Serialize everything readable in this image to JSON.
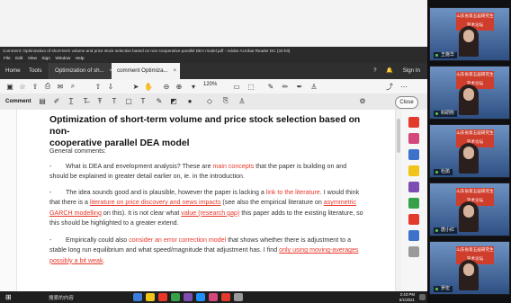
{
  "app": {
    "window_title": "Comment: Optimization of short-term volume and price stock selection based on non-cooperative parallel DEA model.pdf - Adobe Acrobat Reader DC (32-bit)",
    "menu": [
      "File",
      "Edit",
      "View",
      "Sign",
      "Window",
      "Help"
    ],
    "tabs": [
      {
        "label": "Home"
      },
      {
        "label": "Tools"
      },
      {
        "label": "Optimization of sh..."
      },
      {
        "label": "comment Optimiza..."
      }
    ],
    "top_right": {
      "help": "?",
      "bell": "🔔",
      "signin": "Sign In"
    },
    "toolbar_zoom": "120%",
    "comment_toolbar": {
      "label": "Comment",
      "close_label": "Close"
    }
  },
  "document": {
    "title_line1": "Optimization of short-term volume and price stock selection based on non-",
    "title_line2": "cooperative parallel DEA model",
    "section_heading": "General comments:",
    "p1_dash": "-",
    "p1_pre": "What is DEA and envelopment analysis? These are ",
    "p1_hl": "main concepts",
    "p1_post": " that the paper is building on and should be explained in greater detail earlier on, ie. in the introduction.",
    "p2_dash": "-",
    "p2_a": "The idea sounds good and is plausible, however the paper is lacking a ",
    "p2_hl1": "link to the literature",
    "p2_b": ". I would think that there is a ",
    "p2_hl2": "literature on price discovery and news impacts",
    "p2_c": " (see also the empirical literature on ",
    "p2_hl3": "asymmetric GARCH modelling",
    "p2_d": " on this). It is not clear what ",
    "p2_hl4": "value (research gap)",
    "p2_e": " this paper adds to the existing literature, so this should be highlighted to a greater extend.",
    "p3_dash": "-",
    "p3_a": "Empirically could also ",
    "p3_hl1": "consider an error correction model",
    "p3_b": " that shows whether there is adjustment to a stable long run equilibrium and what speed/magnitude that adjustment has. I find ",
    "p3_hl2": "only using moving-averages possibly a bit weak",
    "p3_c": "."
  },
  "video_call": {
    "banner_text": "山东省第五届研究生学术论坛",
    "participants": [
      {
        "name": "王施华"
      },
      {
        "name": "科研所"
      },
      {
        "name": "杜鹃"
      },
      {
        "name": "唐小红"
      },
      {
        "name": "罗宏"
      }
    ]
  },
  "taskbar": {
    "search_text": "搜索的内容",
    "time": "2:43 PM",
    "date": "6/1/2021"
  },
  "colors": {
    "accent_red": "#e8372a",
    "comment_tool_yellow": "#f0c419",
    "taskbar": "#1f1f1f"
  }
}
